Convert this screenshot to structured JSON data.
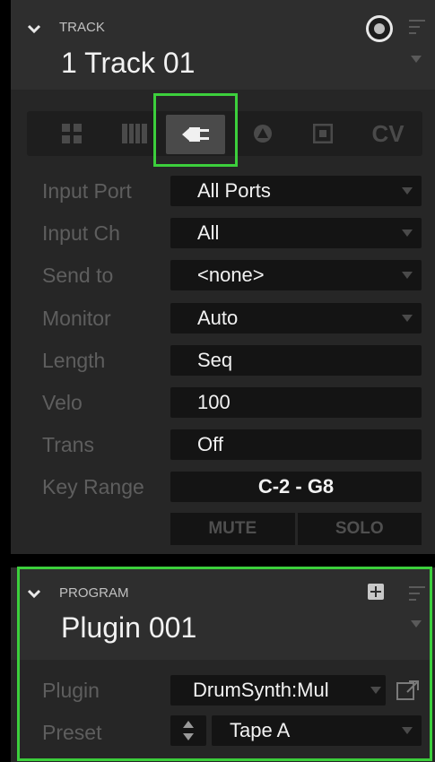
{
  "track": {
    "section_label": "TRACK",
    "title": "1 Track 01",
    "tabs": [
      {
        "name": "grid",
        "label": ""
      },
      {
        "name": "keyboard",
        "label": ""
      },
      {
        "name": "plug",
        "label": ""
      },
      {
        "name": "sample",
        "label": ""
      },
      {
        "name": "route",
        "label": ""
      },
      {
        "name": "cv",
        "label": "CV"
      }
    ],
    "rows": [
      {
        "label": "Input Port",
        "value": "All Ports",
        "dropdown": true
      },
      {
        "label": "Input Ch",
        "value": "All",
        "dropdown": true
      },
      {
        "label": "Send to",
        "value": "<none>",
        "dropdown": true
      },
      {
        "label": "Monitor",
        "value": "Auto",
        "dropdown": true
      },
      {
        "label": "Length",
        "value": "Seq",
        "dropdown": false
      },
      {
        "label": "Velo",
        "value": "100",
        "dropdown": false
      },
      {
        "label": "Trans",
        "value": "Off",
        "dropdown": false
      },
      {
        "label": "Key Range",
        "value": "C-2 - G8",
        "dropdown": false
      }
    ],
    "mute_label": "MUTE",
    "solo_label": "SOLO"
  },
  "program": {
    "section_label": "PROGRAM",
    "title": "Plugin 001",
    "plugin_label": "Plugin",
    "plugin_value": "DrumSynth:Mul",
    "preset_label": "Preset",
    "preset_value": "Tape A"
  },
  "colors": {
    "highlight": "#3ccf3c",
    "header_bg": "#2e2e2e",
    "body_bg": "#262626",
    "field_bg": "#141414"
  }
}
